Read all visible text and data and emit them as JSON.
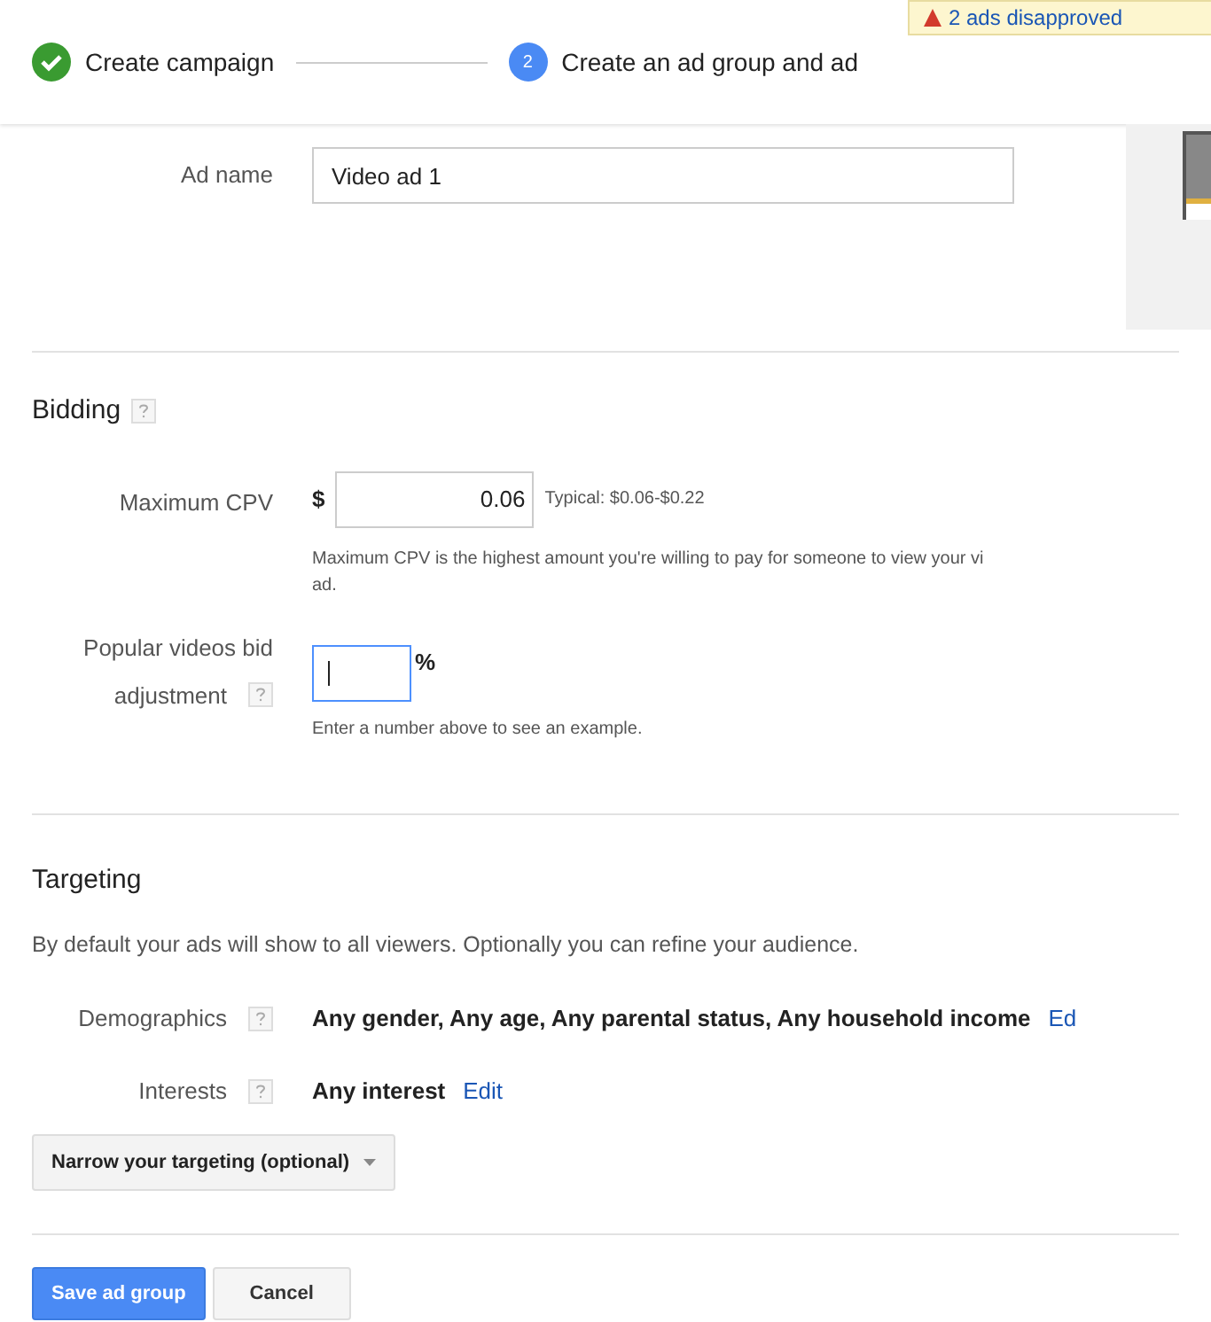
{
  "steps": [
    {
      "label": "Create campaign",
      "done": true
    },
    {
      "label": "Create an ad group and ad",
      "number": "2",
      "done": false
    }
  ],
  "notice": {
    "text": "2 ads disapproved"
  },
  "ad_name": {
    "label": "Ad name",
    "value": "Video ad 1"
  },
  "bidding": {
    "title": "Bidding",
    "max_cpv": {
      "label": "Maximum CPV",
      "currency": "$",
      "value": "0.06",
      "typical": "Typical: $0.06-$0.22",
      "help_lines": [
        "Maximum CPV is the highest amount you're willing to pay for someone to view your vi",
        "ad."
      ]
    },
    "popular": {
      "label_lines": [
        "Popular videos bid",
        "adjustment"
      ],
      "suffix": "%",
      "focused": true,
      "help": "Enter a number above to see an example."
    }
  },
  "targeting": {
    "title": "Targeting",
    "description": "By default your ads will show to all viewers. Optionally you can refine your audience.",
    "rows": [
      {
        "label": "Demographics",
        "value": "Any gender, Any age, Any parental status, Any household income",
        "link": "Ed"
      },
      {
        "label": "Interests",
        "value": "Any interest",
        "link": "Edit"
      }
    ],
    "narrow": "Narrow your targeting (optional)"
  },
  "buttons": [
    {
      "label": "Save ad group",
      "kind": "primary"
    },
    {
      "label": "Cancel",
      "kind": "secondary"
    }
  ]
}
